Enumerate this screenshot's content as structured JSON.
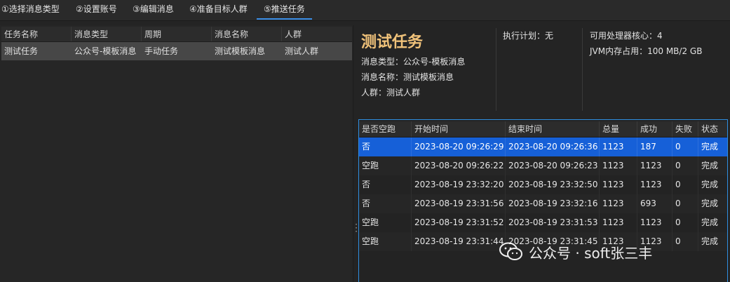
{
  "tabs": [
    {
      "label": "①选择消息类型"
    },
    {
      "label": "②设置账号"
    },
    {
      "label": "③编辑消息"
    },
    {
      "label": "④准备目标人群"
    },
    {
      "label": "⑤推送任务"
    }
  ],
  "left_table": {
    "headers": [
      "任务名称",
      "消息类型",
      "周期",
      "消息名称",
      "人群"
    ],
    "rows": [
      [
        "测试任务",
        "公众号-模板消息",
        "手动任务",
        "测试模板消息",
        "测试人群"
      ]
    ]
  },
  "info": {
    "title": "测试任务",
    "message_type": "消息类型：公众号-模板消息",
    "message_name": "消息名称：测试模板消息",
    "audience": "人群：测试人群",
    "plan": "执行计划：无",
    "cpu_cores": "可用处理器核心：4",
    "jvm_memory": "JVM内存占用：100 MB/2 GB"
  },
  "history_table": {
    "headers": [
      "是否空跑",
      "开始时间",
      "结束时间",
      "总量",
      "成功",
      "失败",
      "状态"
    ],
    "rows": [
      [
        "否",
        "2023-08-20 09:26:29",
        "2023-08-20 09:26:36",
        "1123",
        "187",
        "0",
        "完成"
      ],
      [
        "空跑",
        "2023-08-20 09:26:22",
        "2023-08-20 09:26:23",
        "1123",
        "1123",
        "0",
        "完成"
      ],
      [
        "否",
        "2023-08-19 23:32:20",
        "2023-08-19 23:32:50",
        "1123",
        "1123",
        "0",
        "完成"
      ],
      [
        "否",
        "2023-08-19 23:31:56",
        "2023-08-19 23:32:16",
        "1123",
        "693",
        "0",
        "完成"
      ],
      [
        "空跑",
        "2023-08-19 23:31:52",
        "2023-08-19 23:31:53",
        "1123",
        "1123",
        "0",
        "完成"
      ],
      [
        "空跑",
        "2023-08-19 23:31:44",
        "2023-08-19 23:31:45",
        "1123",
        "1123",
        "0",
        "完成"
      ]
    ]
  },
  "watermark": {
    "text": "公众号 · soft张三丰",
    "icon": "wechat-icon"
  },
  "colors": {
    "accent": "#2f8ee0",
    "selected_row": "#1660d8",
    "title": "#f0c27a"
  }
}
